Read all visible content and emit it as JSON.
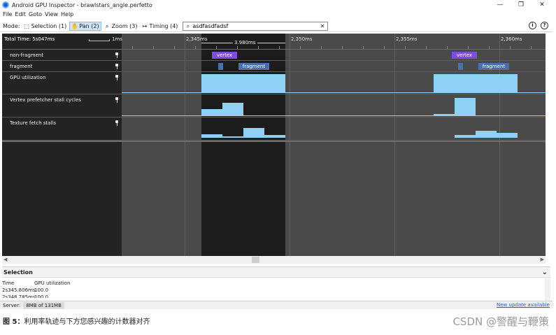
{
  "window": {
    "title": "Android GPU Inspector - brawlstars_angle.perfetto",
    "minimize": "—",
    "maximize": "❐",
    "close": "✕"
  },
  "menu": [
    "File",
    "Edit",
    "Goto",
    "View",
    "Help"
  ],
  "toolbar": {
    "mode_label": "Mode:",
    "modes": [
      {
        "label": "Selection (1)",
        "icon": "⬚"
      },
      {
        "label": "Pan (2)",
        "icon": "✋"
      },
      {
        "label": "Zoom (3)",
        "icon": "⌕"
      },
      {
        "label": "Timing (4)",
        "icon": "↦"
      }
    ],
    "search_value": "asdfasdfadsf",
    "search_icon": "⌕",
    "clear_icon": "✕",
    "info_icon": "i",
    "help_icon": "?"
  },
  "timeline": {
    "total_time": "Total Time: 5s047ms",
    "scale_label": "1ms",
    "ticks": [
      "2,345ms",
      "2,350ms",
      "2,355ms",
      "2,360ms"
    ],
    "selection_duration": "3.980ms",
    "tracks": [
      {
        "name": "non-fragment",
        "slices": [
          {
            "label": "vertex"
          },
          {
            "label": "vertex"
          }
        ]
      },
      {
        "name": "fragment",
        "slices": [
          {
            "label": ""
          },
          {
            "label": "fragment"
          },
          {
            "label": ""
          },
          {
            "label": "fragment"
          }
        ]
      },
      {
        "name": "GPU utilization"
      },
      {
        "name": "Vertex prefetcher stall cycles"
      },
      {
        "name": "Texture fetch stalls"
      }
    ]
  },
  "selection_panel": {
    "title": "Selection",
    "columns": [
      "Time",
      "GPU utilization"
    ],
    "rows": [
      [
        "2s345.806ms",
        "100.0"
      ],
      [
        "2s348.785ms",
        "100.0"
      ]
    ]
  },
  "status": {
    "server_label": "Server:",
    "memory": "8MB of 131MB",
    "update_link": "New update available"
  },
  "caption": {
    "prefix": "图 5：",
    "text": "利用率轨迹与下方您感兴趣的计数器对齐"
  },
  "watermark": "CSDN @警醒与鞭策",
  "colors": {
    "vertex": "#7e4ddd",
    "fragment": "#4c6fa8",
    "counter": "#8fd0f5",
    "selection": "#1c1c1c"
  }
}
